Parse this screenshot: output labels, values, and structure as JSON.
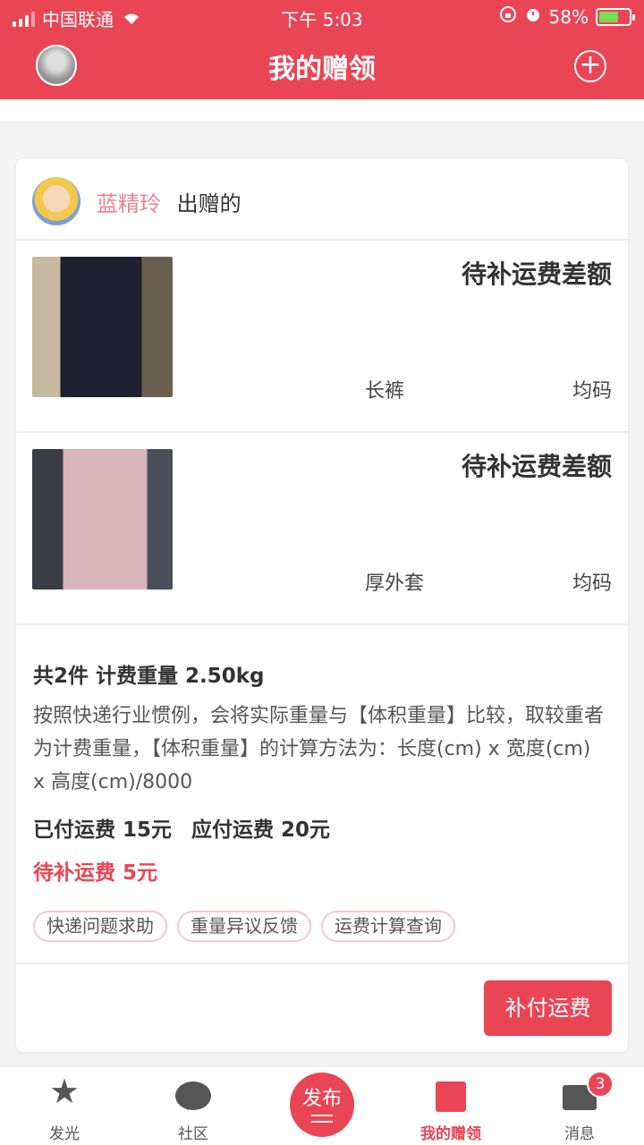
{
  "status_bar": {
    "carrier": "中国联通",
    "time": "下午 5:03",
    "battery": "58%",
    "battery_level": 0.58
  },
  "header": {
    "title": "我的赠领",
    "add_icon": "plus-circle-icon"
  },
  "card": {
    "donor_name": "蓝精玲",
    "donor_suffix": "出赠的",
    "items": [
      {
        "status": "待补运费差额",
        "name": "长裤",
        "size": "均码"
      },
      {
        "status": "待补运费差额",
        "name": "厚外套",
        "size": "均码"
      }
    ],
    "total": "共2件 计费重量 2.50kg",
    "description": "按照快递行业惯例，会将实际重量与【体积重量】比较，取较重者为计费重量，【体积重量】的计算方法为：长度(cm) x 宽度(cm) x 高度(cm)/8000",
    "paid": "已付运费 15元",
    "should_pay": "应付运费 20元",
    "due": "待补运费 5元",
    "tags": [
      "快递问题求助",
      "重量异议反馈",
      "运费计算查询"
    ],
    "pay_button": "补付运费"
  },
  "tabbar": {
    "tabs": [
      {
        "label": "发光",
        "icon": "star-icon"
      },
      {
        "label": "社区",
        "icon": "chat-bubble-icon"
      },
      {
        "label": "发布",
        "icon": "publish-icon"
      },
      {
        "label": "我的赠领",
        "icon": "gift-box-icon"
      },
      {
        "label": "消息",
        "icon": "mail-icon",
        "badge": "3"
      }
    ],
    "active_index": 3
  },
  "colors": {
    "primary": "#e94555",
    "donor_name": "#e9838e"
  }
}
